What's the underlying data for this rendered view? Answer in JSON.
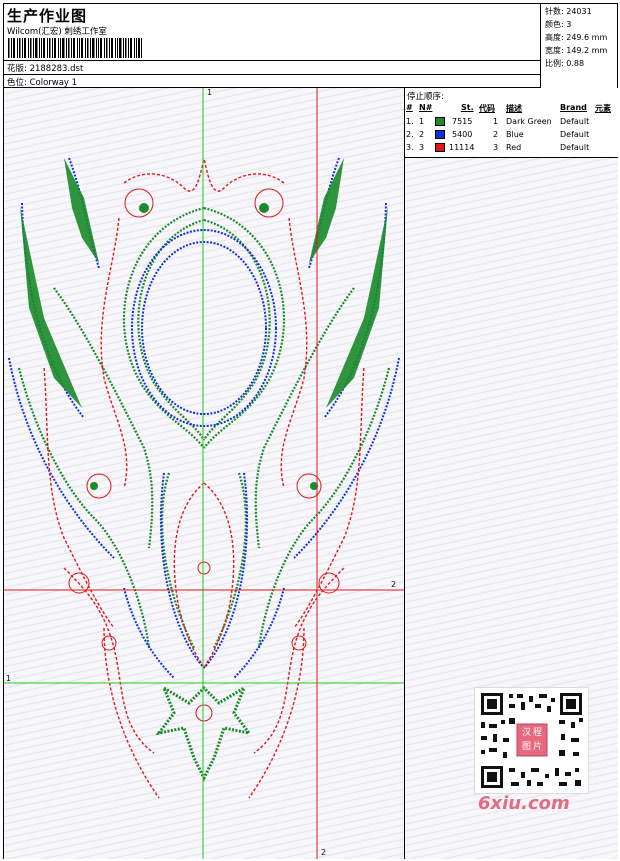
{
  "header": {
    "title": "生产作业图",
    "studio": "Wilcom(汇宏) 刺绣工作室",
    "design_label": "花版: 2188283.dst",
    "colorway_label": "色位: Colorway 1"
  },
  "stats": {
    "stitches": "针数: 24031",
    "colors": "颜色: 3",
    "height": "高度: 249.6 mm",
    "width": "宽度: 149.2 mm",
    "scale": "比例: 0.88"
  },
  "stop_sequence": {
    "title": "停止顺序:",
    "headers": {
      "num": "#",
      "n": "N#",
      "st": "St.",
      "code": "代码",
      "desc": "描述",
      "brand": "Brand",
      "elements": "元素"
    },
    "rows": [
      {
        "num": "1.",
        "n": "1",
        "color": "#1a8a2a",
        "st": "7515",
        "code": "1",
        "desc": "Dark Green",
        "brand": "Default"
      },
      {
        "num": "2.",
        "n": "2",
        "color": "#1030e0",
        "st": "5400",
        "code": "2",
        "desc": "Blue",
        "brand": "Default"
      },
      {
        "num": "3.",
        "n": "3",
        "color": "#e01818",
        "st": "11114",
        "code": "3",
        "desc": "Red",
        "brand": "Default"
      }
    ]
  },
  "guides": {
    "v1": "1",
    "h1": "1",
    "h2": "2",
    "v2": "2"
  },
  "watermark": "6xiu.com",
  "qr_badge": "汉程图片"
}
